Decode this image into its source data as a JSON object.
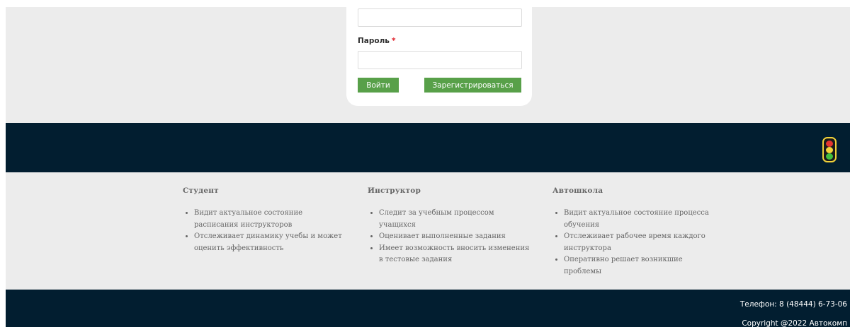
{
  "login_form": {
    "login_value": "",
    "password_label": "Пароль",
    "required_mark": "*",
    "password_value": "",
    "login_button": "Войти",
    "register_button": "Зарегистрироваться"
  },
  "header_band": {
    "logo_icon": "traffic-light-icon",
    "colors": {
      "background": "#021e30",
      "red": "#e33530",
      "yellow": "#f2d23a",
      "green": "#3fbf3f"
    }
  },
  "info": {
    "columns": [
      {
        "title": "Студент",
        "items": [
          "Видит актуальное состояние расписания инструкторов",
          "Отслеживает динамику учебы и может оценить эффективность"
        ]
      },
      {
        "title": "Инструктор",
        "items": [
          "Следит за учебным процессом учащихся",
          "Оценивает выполненные задания",
          "Имеет возможность вносить изменения в тестовые задания"
        ]
      },
      {
        "title": "Автошкола",
        "items": [
          "Видит актуальное состояние процесса обучения",
          "Отслеживает рабочее время каждого инструктора",
          "Оперативно решает возникшие проблемы"
        ]
      }
    ]
  },
  "footer": {
    "phone": "Телефон: 8 (48444) 6-73-06",
    "copyright": "Copyright @2022 Автокомп"
  },
  "colors": {
    "accent_button": "#58a049",
    "section_background": "#ececec",
    "required": "#e0202a"
  }
}
